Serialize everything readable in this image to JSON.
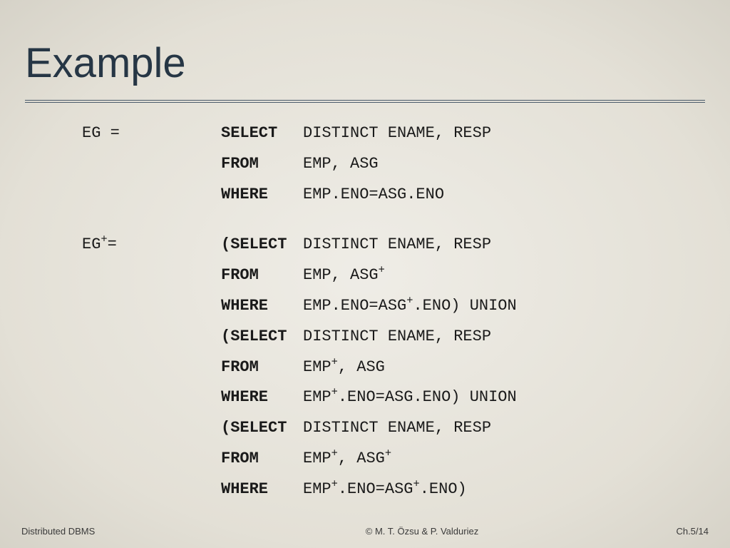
{
  "title": "Example",
  "blocks": [
    {
      "label_html": "EG =",
      "rows": [
        {
          "kw": "SELECT",
          "rest_html": "DISTINCT ENAME, RESP"
        },
        {
          "kw": "FROM",
          "rest_html": "EMP, ASG"
        },
        {
          "kw": "WHERE",
          "rest_html": "EMP.ENO=ASG.ENO"
        }
      ]
    },
    {
      "label_html": "EG<span class=\"sup\">+</span>=",
      "rows": [
        {
          "kw": "(SELECT",
          "rest_html": "DISTINCT ENAME, RESP"
        },
        {
          "kw": "FROM",
          "rest_html": "EMP, ASG<span class=\"sup\">+</span>"
        },
        {
          "kw": "WHERE",
          "rest_html": "EMP.ENO=ASG<span class=\"sup\">+</span>.ENO) UNION"
        },
        {
          "kw": "(SELECT",
          "rest_html": "DISTINCT ENAME, RESP"
        },
        {
          "kw": "FROM",
          "rest_html": "EMP<span class=\"sup\">+</span>, ASG"
        },
        {
          "kw": "WHERE",
          "rest_html": "EMP<span class=\"sup\">+</span>.ENO=ASG.ENO) UNION"
        },
        {
          "kw": "(SELECT",
          "rest_html": "DISTINCT ENAME, RESP"
        },
        {
          "kw": "FROM",
          "rest_html": "EMP<span class=\"sup\">+</span>, ASG<span class=\"sup\">+</span>"
        },
        {
          "kw": "WHERE",
          "rest_html": "EMP<span class=\"sup\">+</span>.ENO=ASG<span class=\"sup\">+</span>.ENO)"
        }
      ]
    }
  ],
  "footer": {
    "left": "Distributed DBMS",
    "center": "© M. T. Özsu & P. Valduriez",
    "right": "Ch.5/14"
  }
}
